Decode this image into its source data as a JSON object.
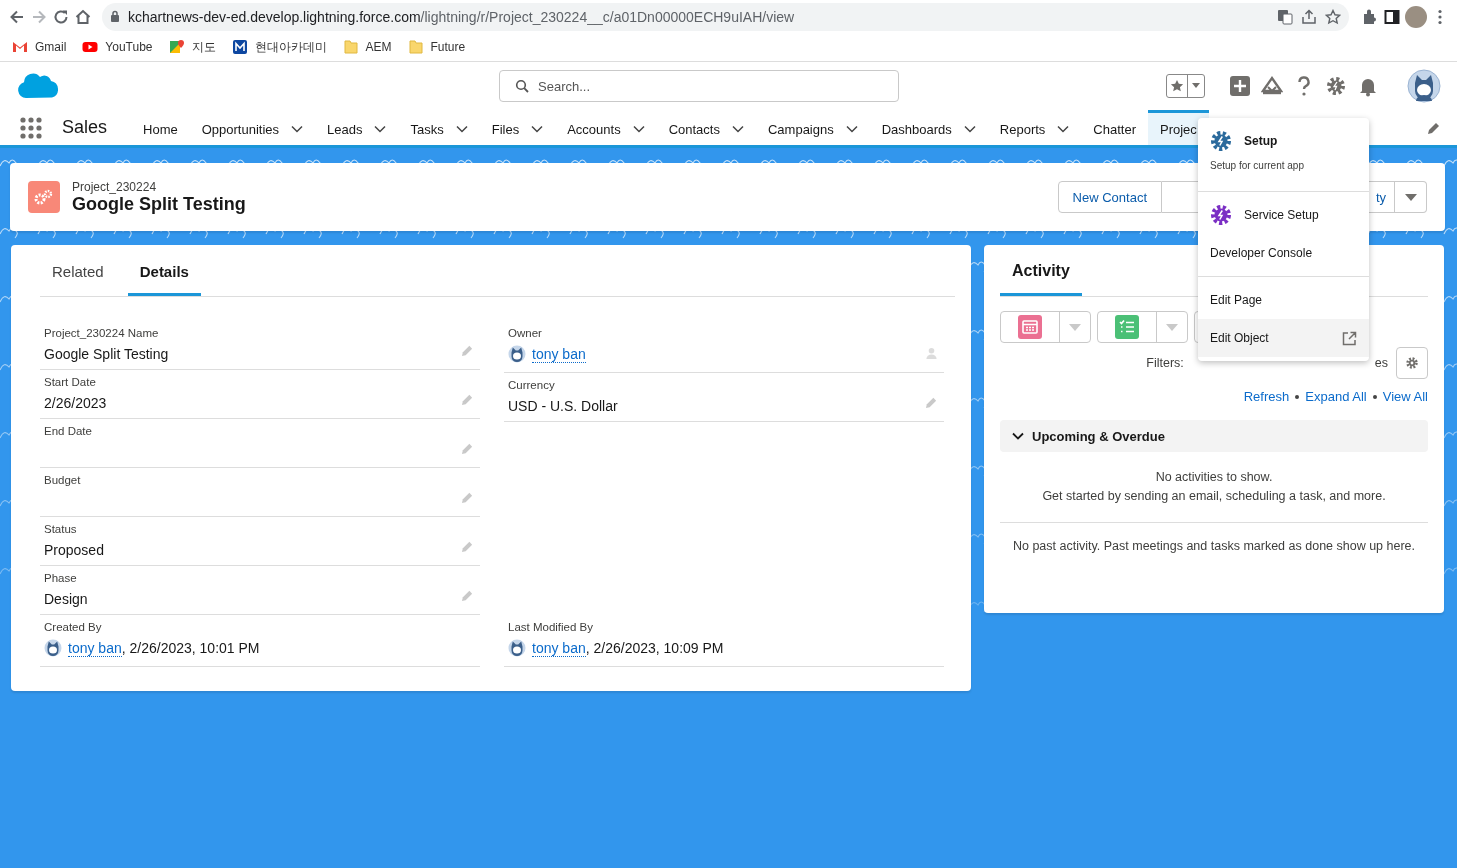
{
  "browser": {
    "url_host": "kchartnews-dev-ed.develop.lightning.force.com",
    "url_path": "/lightning/r/Project_230224__c/a01Dn00000ECH9uIAH/view"
  },
  "bookmarks": [
    {
      "label": "Gmail",
      "kind": "gmail"
    },
    {
      "label": "YouTube",
      "kind": "youtube"
    },
    {
      "label": "지도",
      "kind": "maps"
    },
    {
      "label": "현대아카데미",
      "kind": "m"
    },
    {
      "label": "AEM",
      "kind": "folder"
    },
    {
      "label": "Future",
      "kind": "folder"
    }
  ],
  "header": {
    "search_placeholder": "Search..."
  },
  "nav": {
    "app_name": "Sales",
    "items": [
      {
        "label": "Home",
        "menu": false,
        "selected": false
      },
      {
        "label": "Opportunities",
        "menu": true,
        "selected": false
      },
      {
        "label": "Leads",
        "menu": true,
        "selected": false
      },
      {
        "label": "Tasks",
        "menu": true,
        "selected": false
      },
      {
        "label": "Files",
        "menu": true,
        "selected": false
      },
      {
        "label": "Accounts",
        "menu": true,
        "selected": false
      },
      {
        "label": "Contacts",
        "menu": true,
        "selected": false
      },
      {
        "label": "Campaigns",
        "menu": true,
        "selected": false
      },
      {
        "label": "Dashboards",
        "menu": true,
        "selected": false
      },
      {
        "label": "Reports",
        "menu": true,
        "selected": false
      },
      {
        "label": "Chatter",
        "menu": false,
        "selected": false
      },
      {
        "label": "Projec",
        "menu": false,
        "selected": true
      }
    ]
  },
  "record": {
    "object_label": "Project_230224",
    "title": "Google Split Testing",
    "actions": [
      "New Contact",
      "ty"
    ]
  },
  "details": {
    "tabs": [
      {
        "label": "Related",
        "selected": false
      },
      {
        "label": "Details",
        "selected": true
      }
    ],
    "left_fields": [
      {
        "label": "Project_230224 Name",
        "kind": "text",
        "value": "Google Split Testing",
        "editable": true
      },
      {
        "label": "Start Date",
        "kind": "text",
        "value": "2/26/2023",
        "editable": true
      },
      {
        "label": "End Date",
        "kind": "text",
        "editable": true
      },
      {
        "label": "Budget",
        "kind": "text",
        "editable": true
      },
      {
        "label": "Status",
        "kind": "text",
        "value": "Proposed",
        "editable": true
      },
      {
        "label": "Phase",
        "kind": "text",
        "value": "Design",
        "editable": true
      },
      {
        "label": "Created By",
        "kind": "user",
        "value": "tony ban",
        "suffix": ", 2/26/2023, 10:01 PM",
        "editable": false
      }
    ],
    "right_fields": [
      {
        "label": "Owner",
        "kind": "user",
        "value": "tony ban",
        "editable": true
      },
      {
        "label": "Currency",
        "kind": "text",
        "value": "USD - U.S. Dollar",
        "editable": true
      },
      {
        "label": "Last Modified By",
        "kind": "user",
        "value": "tony ban",
        "suffix": ", 2/26/2023, 10:09 PM",
        "editable": false
      }
    ]
  },
  "activity": {
    "title": "Activity",
    "tools": [
      {
        "kind": "event",
        "color": "#eb7092"
      },
      {
        "kind": "task",
        "color": "#4bc076"
      },
      {
        "kind": "hidden"
      }
    ],
    "filters_label": "Filters:",
    "filters_tail": "es",
    "links": [
      "Refresh",
      "Expand All",
      "View All"
    ],
    "section": {
      "title": "Upcoming & Overdue",
      "expanded": true
    },
    "empty_lines": [
      "No activities to show.",
      "Get started by sending an email, scheduling a task, and more."
    ],
    "past": "No past activity. Past meetings and tasks marked as done show up here."
  },
  "setup_menu": {
    "sections": [
      [
        {
          "label": "Setup",
          "kind": "setup",
          "emphasis": true,
          "description": "Setup for current app",
          "color": "#2b6a9c",
          "selected": false
        }
      ],
      [
        {
          "label": "Service Setup",
          "kind": "setup",
          "emphasis": false,
          "color": "#7b2fc4",
          "selected": false
        },
        {
          "label": "Developer Console",
          "kind": "plain",
          "emphasis": false,
          "selected": false
        }
      ],
      [
        {
          "label": "Edit Page",
          "kind": "plain",
          "emphasis": false,
          "selected": false
        },
        {
          "label": "Edit Object",
          "kind": "external",
          "emphasis": false,
          "selected": true
        }
      ]
    ]
  }
}
